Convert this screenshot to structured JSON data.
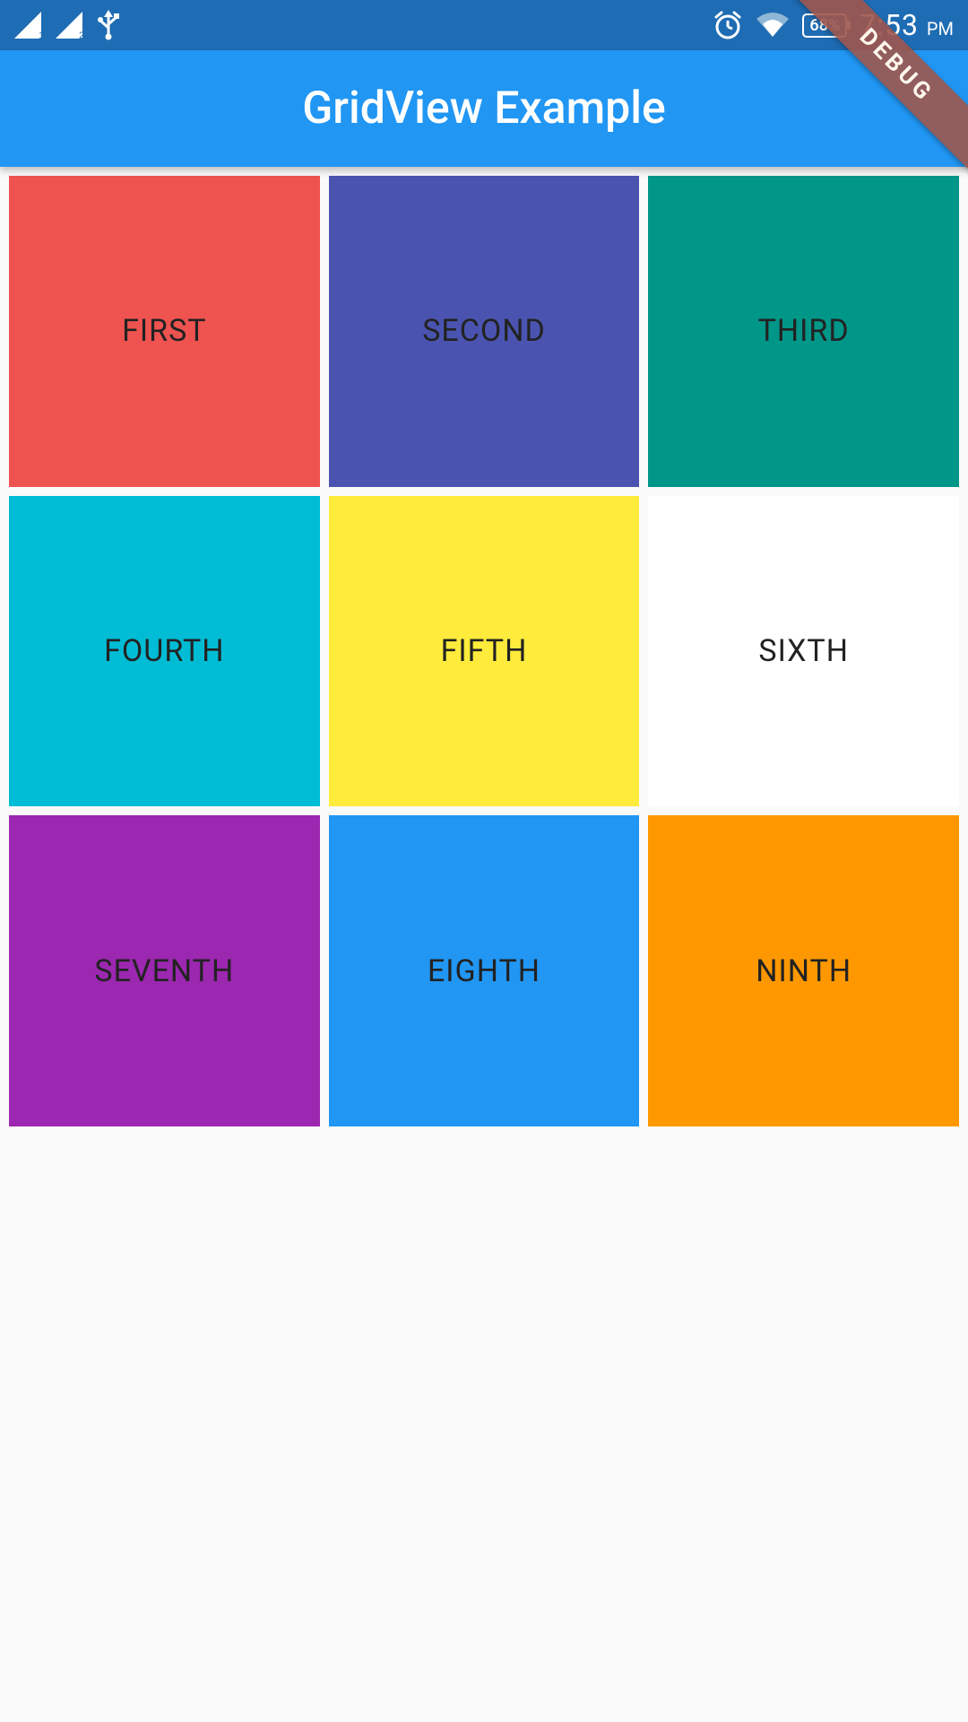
{
  "status": {
    "signal1_sub": "1",
    "signal2_sub": "2",
    "usb_icon": "usb-icon",
    "alarm_icon": "alarm-icon",
    "wifi_icon": "wifi-icon",
    "battery_text": "68%",
    "time": "7:53",
    "ampm": "PM"
  },
  "appbar": {
    "title": "GridView Example"
  },
  "debug_ribbon": "DEBUG",
  "grid": {
    "tiles": [
      {
        "label": "FIRST",
        "color": "#ef5350"
      },
      {
        "label": "SECOND",
        "color": "#4a54b0"
      },
      {
        "label": "THIRD",
        "color": "#009688"
      },
      {
        "label": "FOURTH",
        "color": "#00bcd4"
      },
      {
        "label": "FIFTH",
        "color": "#ffeb3b"
      },
      {
        "label": "SIXTH",
        "color": "#ffffff"
      },
      {
        "label": "SEVENTH",
        "color": "#9c27b0"
      },
      {
        "label": "EIGHTH",
        "color": "#2196f3"
      },
      {
        "label": "NINTH",
        "color": "#ff9800"
      }
    ]
  }
}
